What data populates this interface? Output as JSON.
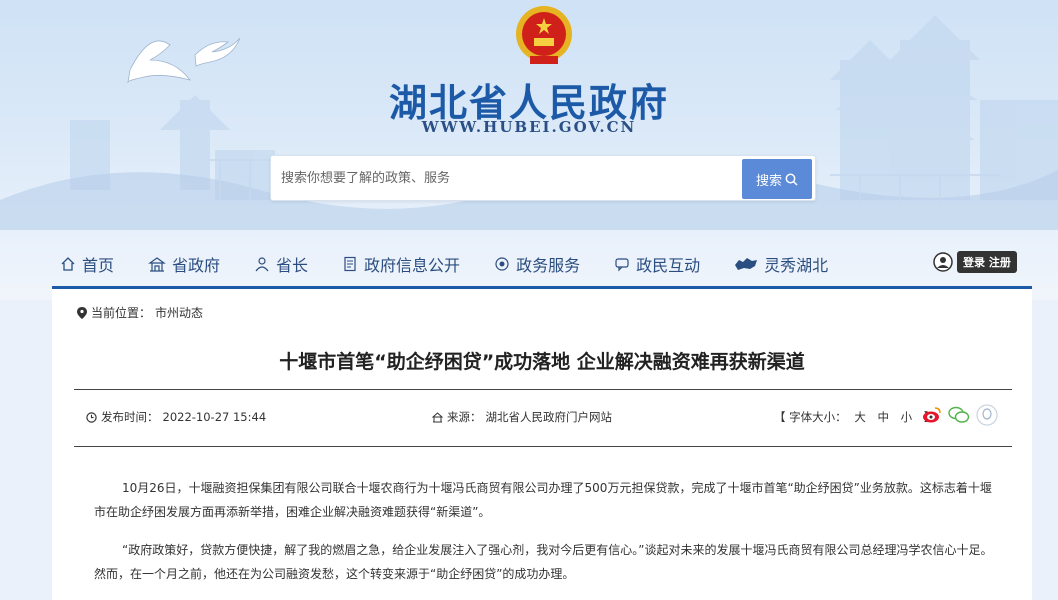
{
  "site": {
    "title": "湖北省人民政府",
    "url": "WWW.HUBEI.GOV.CN"
  },
  "search": {
    "placeholder": "搜索你想要了解的政策、服务",
    "button_label": "搜索"
  },
  "nav": {
    "items": [
      {
        "label": "首页",
        "icon": "home-icon"
      },
      {
        "label": "省政府",
        "icon": "building-icon"
      },
      {
        "label": "省长",
        "icon": "person-icon"
      },
      {
        "label": "政府信息公开",
        "icon": "document-icon"
      },
      {
        "label": "政务服务",
        "icon": "service-icon"
      },
      {
        "label": "政民互动",
        "icon": "chat-icon"
      },
      {
        "label": "灵秀湖北",
        "icon": "map-icon"
      }
    ],
    "login_label": "登录 注册"
  },
  "breadcrumb": {
    "prefix": "当前位置：",
    "current": "市州动态"
  },
  "article": {
    "title": "十堰市首笔“助企纾困贷”成功落地 企业解决融资难再获新渠道",
    "date_label": "发布时间：",
    "date": "2022-10-27 15:44",
    "source_label": "来源：",
    "source": "湖北省人民政府门户网站",
    "font_size_label": "【 字体大小：",
    "font_sizes": [
      "大",
      "中",
      "小"
    ],
    "font_size_end": "】",
    "paragraphs": [
      "10月26日，十堰融资担保集团有限公司联合十堰农商行为十堰冯氏商贸有限公司办理了500万元担保贷款，完成了十堰市首笔“助企纾困贷”业务放款。这标志着十堰市在助企纾困发展方面再添新举措，困难企业解决融资难题获得“新渠道”。",
      "“政府政策好，贷款方便快捷，解了我的燃眉之急，给企业发展注入了强心剂，我对今后更有信心。”谈起对未来的发展十堰冯氏商贸有限公司总经理冯学农信心十足。然而，在一个月之前，他还在为公司融资发愁，这个转变来源于“助企纾困贷”的成功办理。"
    ]
  },
  "colors": {
    "brand": "#1c5aa8",
    "search_button": "#5b8ad8"
  }
}
